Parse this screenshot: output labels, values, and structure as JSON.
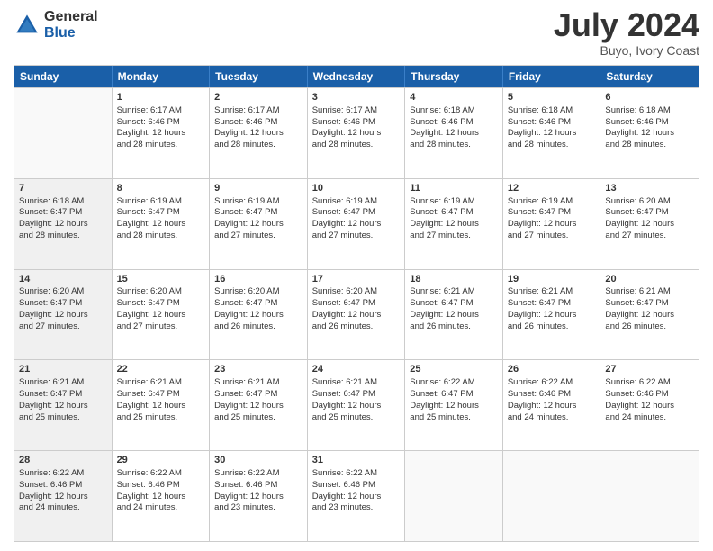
{
  "logo": {
    "general": "General",
    "blue": "Blue"
  },
  "title": "July 2024",
  "location": "Buyo, Ivory Coast",
  "header_days": [
    "Sunday",
    "Monday",
    "Tuesday",
    "Wednesday",
    "Thursday",
    "Friday",
    "Saturday"
  ],
  "weeks": [
    [
      {
        "day": "",
        "text": "",
        "shaded": true
      },
      {
        "day": "1",
        "text": "Sunrise: 6:17 AM\nSunset: 6:46 PM\nDaylight: 12 hours\nand 28 minutes."
      },
      {
        "day": "2",
        "text": "Sunrise: 6:17 AM\nSunset: 6:46 PM\nDaylight: 12 hours\nand 28 minutes."
      },
      {
        "day": "3",
        "text": "Sunrise: 6:17 AM\nSunset: 6:46 PM\nDaylight: 12 hours\nand 28 minutes."
      },
      {
        "day": "4",
        "text": "Sunrise: 6:18 AM\nSunset: 6:46 PM\nDaylight: 12 hours\nand 28 minutes."
      },
      {
        "day": "5",
        "text": "Sunrise: 6:18 AM\nSunset: 6:46 PM\nDaylight: 12 hours\nand 28 minutes."
      },
      {
        "day": "6",
        "text": "Sunrise: 6:18 AM\nSunset: 6:46 PM\nDaylight: 12 hours\nand 28 minutes."
      }
    ],
    [
      {
        "day": "7",
        "text": "Sunrise: 6:18 AM\nSunset: 6:47 PM\nDaylight: 12 hours\nand 28 minutes.",
        "shaded": true
      },
      {
        "day": "8",
        "text": "Sunrise: 6:19 AM\nSunset: 6:47 PM\nDaylight: 12 hours\nand 28 minutes."
      },
      {
        "day": "9",
        "text": "Sunrise: 6:19 AM\nSunset: 6:47 PM\nDaylight: 12 hours\nand 27 minutes."
      },
      {
        "day": "10",
        "text": "Sunrise: 6:19 AM\nSunset: 6:47 PM\nDaylight: 12 hours\nand 27 minutes."
      },
      {
        "day": "11",
        "text": "Sunrise: 6:19 AM\nSunset: 6:47 PM\nDaylight: 12 hours\nand 27 minutes."
      },
      {
        "day": "12",
        "text": "Sunrise: 6:19 AM\nSunset: 6:47 PM\nDaylight: 12 hours\nand 27 minutes."
      },
      {
        "day": "13",
        "text": "Sunrise: 6:20 AM\nSunset: 6:47 PM\nDaylight: 12 hours\nand 27 minutes."
      }
    ],
    [
      {
        "day": "14",
        "text": "Sunrise: 6:20 AM\nSunset: 6:47 PM\nDaylight: 12 hours\nand 27 minutes.",
        "shaded": true
      },
      {
        "day": "15",
        "text": "Sunrise: 6:20 AM\nSunset: 6:47 PM\nDaylight: 12 hours\nand 27 minutes."
      },
      {
        "day": "16",
        "text": "Sunrise: 6:20 AM\nSunset: 6:47 PM\nDaylight: 12 hours\nand 26 minutes."
      },
      {
        "day": "17",
        "text": "Sunrise: 6:20 AM\nSunset: 6:47 PM\nDaylight: 12 hours\nand 26 minutes."
      },
      {
        "day": "18",
        "text": "Sunrise: 6:21 AM\nSunset: 6:47 PM\nDaylight: 12 hours\nand 26 minutes."
      },
      {
        "day": "19",
        "text": "Sunrise: 6:21 AM\nSunset: 6:47 PM\nDaylight: 12 hours\nand 26 minutes."
      },
      {
        "day": "20",
        "text": "Sunrise: 6:21 AM\nSunset: 6:47 PM\nDaylight: 12 hours\nand 26 minutes."
      }
    ],
    [
      {
        "day": "21",
        "text": "Sunrise: 6:21 AM\nSunset: 6:47 PM\nDaylight: 12 hours\nand 25 minutes.",
        "shaded": true
      },
      {
        "day": "22",
        "text": "Sunrise: 6:21 AM\nSunset: 6:47 PM\nDaylight: 12 hours\nand 25 minutes."
      },
      {
        "day": "23",
        "text": "Sunrise: 6:21 AM\nSunset: 6:47 PM\nDaylight: 12 hours\nand 25 minutes."
      },
      {
        "day": "24",
        "text": "Sunrise: 6:21 AM\nSunset: 6:47 PM\nDaylight: 12 hours\nand 25 minutes."
      },
      {
        "day": "25",
        "text": "Sunrise: 6:22 AM\nSunset: 6:47 PM\nDaylight: 12 hours\nand 25 minutes."
      },
      {
        "day": "26",
        "text": "Sunrise: 6:22 AM\nSunset: 6:46 PM\nDaylight: 12 hours\nand 24 minutes."
      },
      {
        "day": "27",
        "text": "Sunrise: 6:22 AM\nSunset: 6:46 PM\nDaylight: 12 hours\nand 24 minutes."
      }
    ],
    [
      {
        "day": "28",
        "text": "Sunrise: 6:22 AM\nSunset: 6:46 PM\nDaylight: 12 hours\nand 24 minutes.",
        "shaded": true
      },
      {
        "day": "29",
        "text": "Sunrise: 6:22 AM\nSunset: 6:46 PM\nDaylight: 12 hours\nand 24 minutes."
      },
      {
        "day": "30",
        "text": "Sunrise: 6:22 AM\nSunset: 6:46 PM\nDaylight: 12 hours\nand 23 minutes."
      },
      {
        "day": "31",
        "text": "Sunrise: 6:22 AM\nSunset: 6:46 PM\nDaylight: 12 hours\nand 23 minutes."
      },
      {
        "day": "",
        "text": "",
        "shaded": false
      },
      {
        "day": "",
        "text": "",
        "shaded": false
      },
      {
        "day": "",
        "text": "",
        "shaded": false
      }
    ]
  ]
}
